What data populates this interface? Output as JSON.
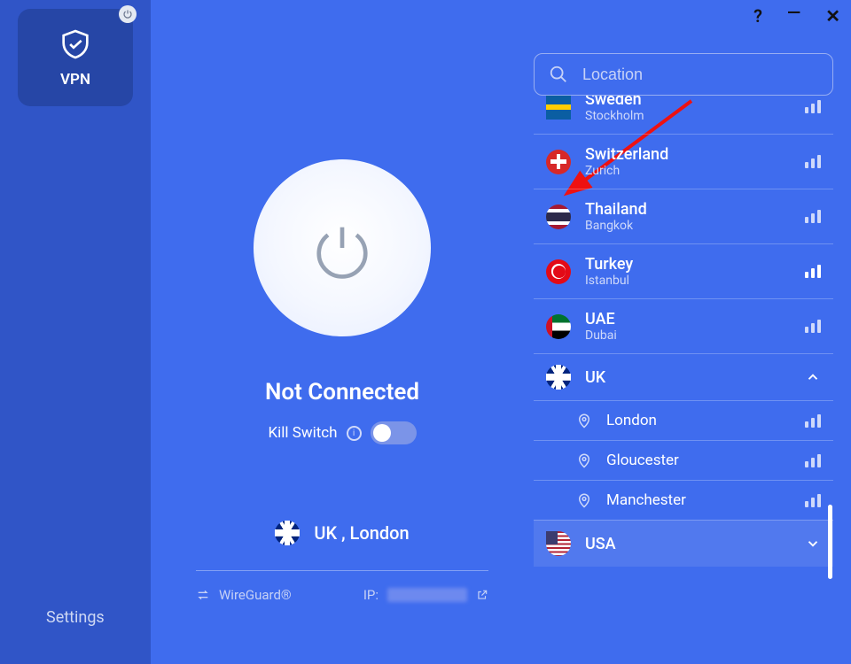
{
  "sidebar": {
    "vpn_label": "VPN",
    "settings_label": "Settings"
  },
  "controls": {
    "help": "?",
    "minimize": "—",
    "close": "✕"
  },
  "status": {
    "text": "Not Connected",
    "kill_switch_label": "Kill Switch",
    "kill_switch_on": false
  },
  "current": {
    "flag": "uk",
    "label": "UK , London"
  },
  "protocol": {
    "name": "WireGuard®",
    "ip_label": "IP:"
  },
  "search": {
    "placeholder": "Location"
  },
  "locations": [
    {
      "id": "se",
      "flag": "se",
      "country": "Sweden",
      "city": "Stockholm",
      "signal": "normal"
    },
    {
      "id": "ch",
      "flag": "ch",
      "country": "Switzerland",
      "city": "Zurich",
      "signal": "normal"
    },
    {
      "id": "th",
      "flag": "th",
      "country": "Thailand",
      "city": "Bangkok",
      "signal": "normal"
    },
    {
      "id": "tr",
      "flag": "tr",
      "country": "Turkey",
      "city": "Istanbul",
      "signal": "strong"
    },
    {
      "id": "ae",
      "flag": "ae",
      "country": "UAE",
      "city": "Dubai",
      "signal": "normal"
    }
  ],
  "expanded": {
    "flag": "uk",
    "country": "UK",
    "cities": [
      {
        "name": "London",
        "signal": "normal"
      },
      {
        "name": "Gloucester",
        "signal": "normal"
      },
      {
        "name": "Manchester",
        "signal": "normal"
      }
    ]
  },
  "next": {
    "flag": "us",
    "country": "USA"
  }
}
